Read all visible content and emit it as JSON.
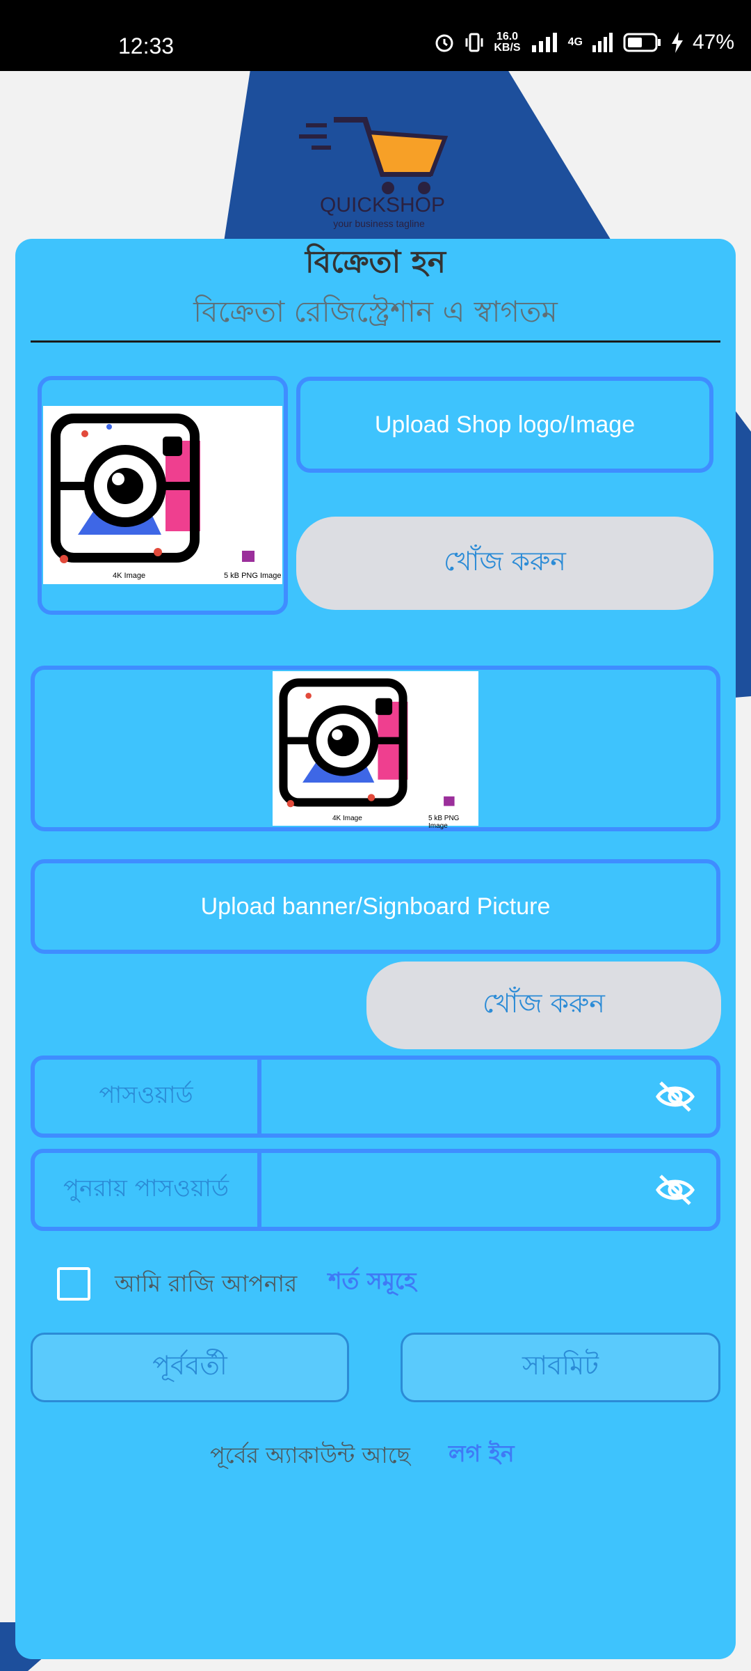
{
  "status_bar": {
    "time": "12:33",
    "net_speed_top": "16.0",
    "net_speed_bottom": "KB/S",
    "network": "4G",
    "battery": "47%"
  },
  "logo": {
    "name": "QUICKSHOP",
    "tagline": "your business tagline"
  },
  "header": {
    "title": "বিক্রেতা হন",
    "subtitle": "বিক্রেতা রেজিস্ট্রেশান এ স্বাগতম"
  },
  "shop_logo": {
    "upload_label": "Upload Shop logo/Image",
    "search_label": "খোঁজ করুন",
    "preview_left_caption": "4K Image",
    "preview_right_caption": "5 kB PNG Image"
  },
  "banner": {
    "upload_label": "Upload banner/Signboard Picture",
    "search_label": "খোঁজ করুন",
    "preview_left_caption": "4K Image",
    "preview_right_caption": "5 kB PNG Image"
  },
  "password": {
    "label": "পাসওয়ার্ড",
    "value": ""
  },
  "confirm_password": {
    "label": "পুনরায় পাসওয়ার্ড",
    "value": ""
  },
  "agreement": {
    "text": "আমি রাজি আপনার",
    "link": "শর্ত সমূহে",
    "checked": false
  },
  "buttons": {
    "previous": "পূর্ববর্তী",
    "submit": "সাবমিট"
  },
  "footer": {
    "text": "পূর্বের অ্যাকাউন্ট আছে",
    "login": "লগ ইন"
  },
  "colors": {
    "card": "#3ec3fd",
    "border": "#3f8dff",
    "bg_shape": "#1d4f9c",
    "link": "#3f7af5"
  }
}
